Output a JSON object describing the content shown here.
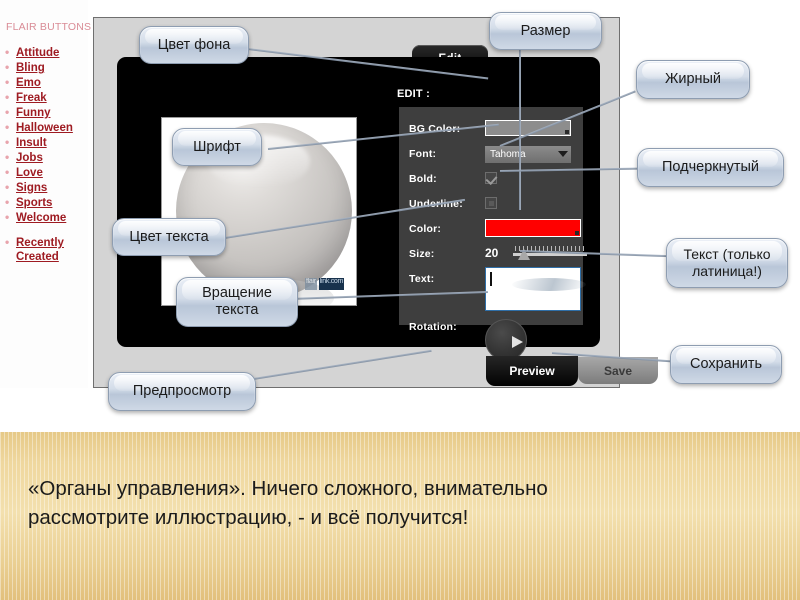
{
  "sidebar": {
    "title": "FLAIR BUTTONS",
    "links": [
      "Attitude",
      "Bling",
      "Emo",
      "Freak",
      "Funny",
      "Halloween",
      "Insult",
      "Jobs",
      "Love",
      "Signs",
      "Sports",
      "Welcome"
    ],
    "recent": "Recently Created"
  },
  "app": {
    "tab_edit": "Edit",
    "edit_heading": "EDIT :",
    "fields": {
      "bg_color_label": "BG Color:",
      "bg_color_value": "#8d8d8d",
      "font_label": "Font:",
      "font_value": "Tahoma",
      "bold_label": "Bold:",
      "bold_checked": "checked",
      "underline_label": "Underline:",
      "underline_checked": "unchecked",
      "color_label": "Color:",
      "color_value": "#ff0000",
      "size_label": "Size:",
      "size_value": "20",
      "text_label": "Text:",
      "text_value": "",
      "rotation_label": "Rotation:"
    },
    "tab_preview": "Preview",
    "tab_save": "Save",
    "watermark_a": "flair",
    "watermark_b": "link.com"
  },
  "callouts": {
    "bg_color": "Цвет фона",
    "size": "Размер",
    "bold": "Жирный",
    "font": "Шрифт",
    "underline": "Подчеркнутый",
    "text_color": "Цвет текста",
    "text_only_latin": "Текст (только латиница!)",
    "rotation": "Вращение текста",
    "preview": "Предпросмотр",
    "save": "Сохранить"
  },
  "caption": {
    "line1": "«Органы управления». Ничего сложного, внимательно",
    "line2": "рассмотрите иллюстрацию, - и всё получится!"
  },
  "colors": {
    "link": "#9e1b22",
    "title": "#d98c96",
    "callout_fill": "#d4dde9",
    "band": "#efd79e",
    "accent_red": "#ff0000"
  }
}
